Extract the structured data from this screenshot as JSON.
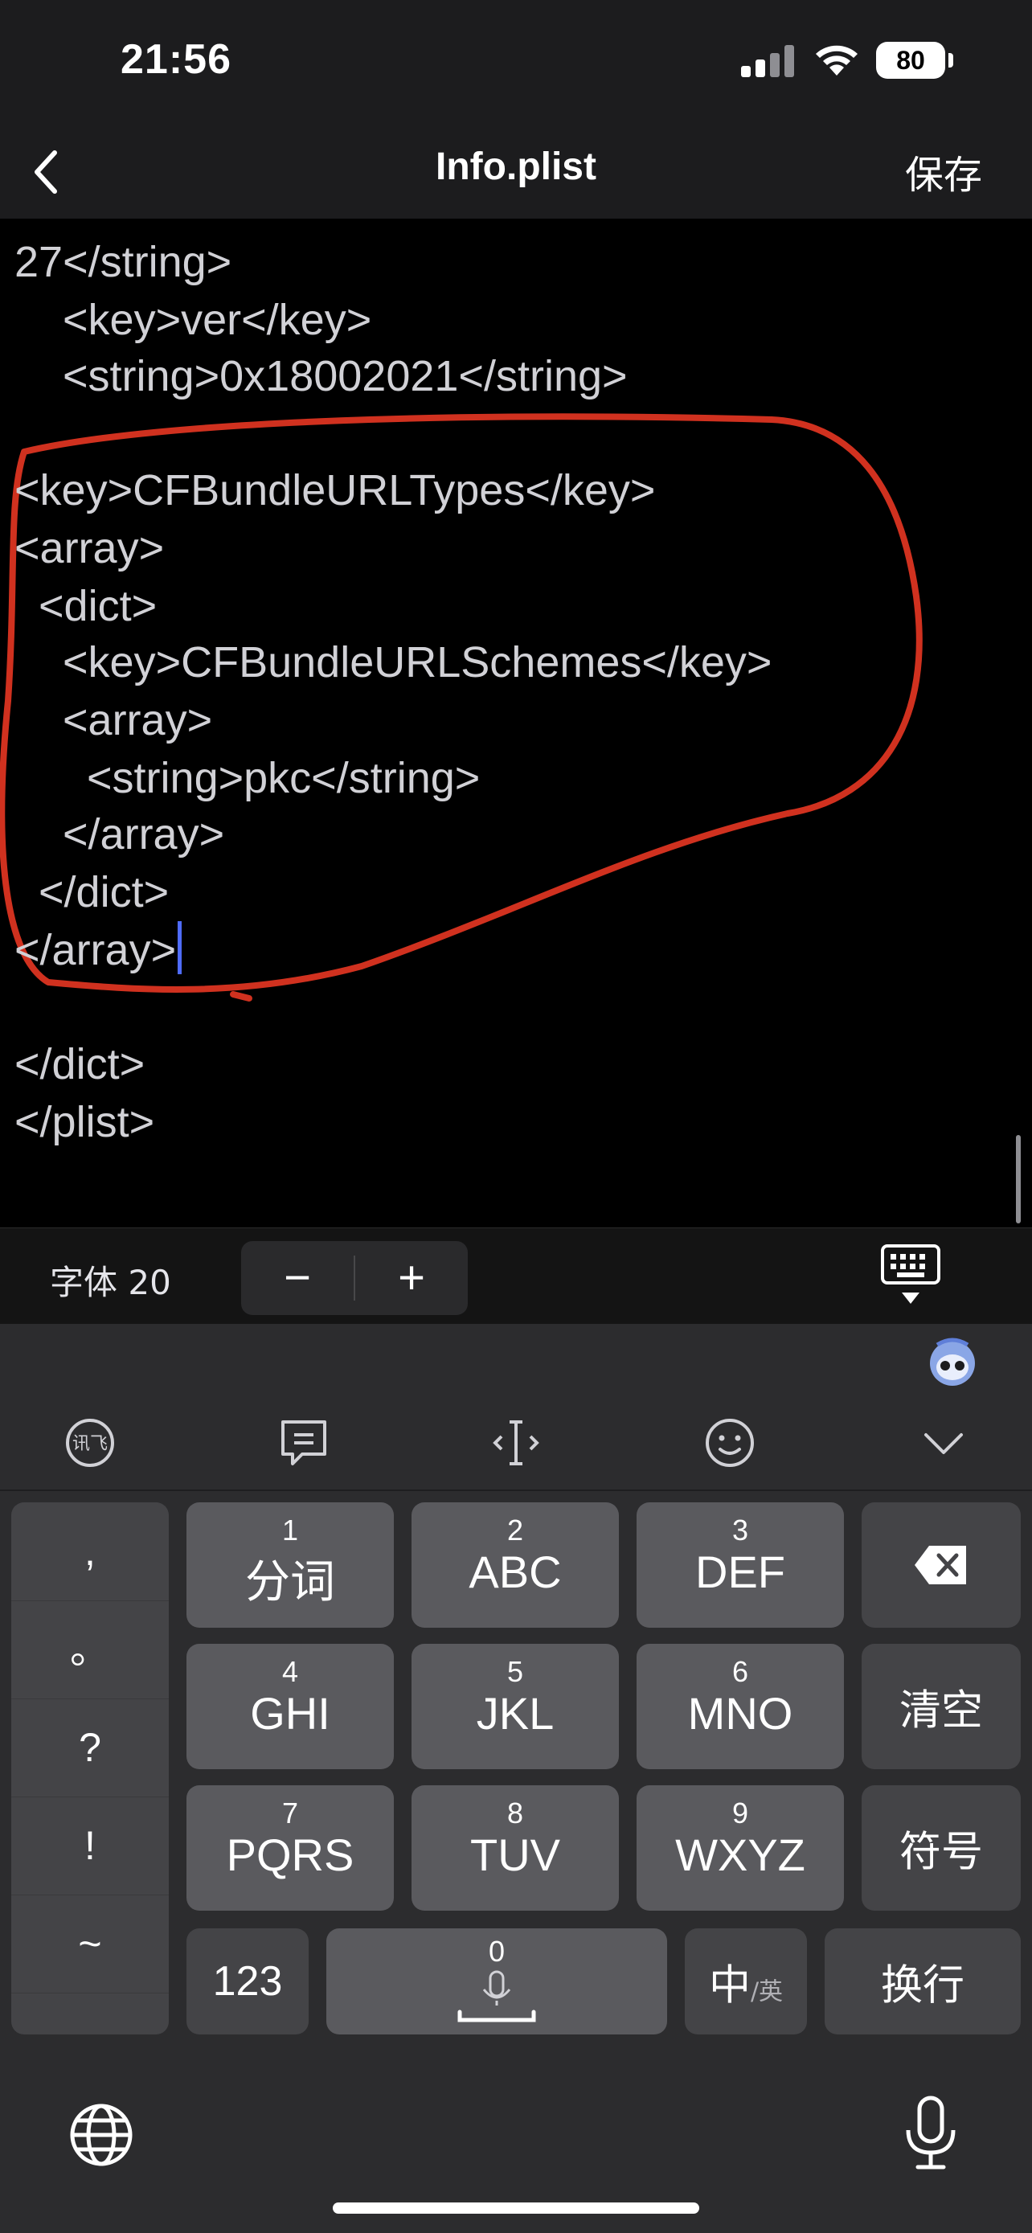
{
  "status_bar": {
    "time": "21:56",
    "battery": "80"
  },
  "nav": {
    "title": "Info.plist",
    "save_label": "保存"
  },
  "editor": {
    "lines": [
      "27</string>",
      "    <key>ver</key>",
      "    <string>0x18002021</string>",
      "",
      "<key>CFBundleURLTypes</key>",
      "<array>",
      "  <dict>",
      "    <key>CFBundleURLSchemes</key>",
      "    <array>",
      "      <string>pkc</string>",
      "    </array>",
      "  </dict>",
      "</array>",
      "",
      "</dict>",
      "</plist>"
    ],
    "annotation_color": "#d0311f",
    "cursor_color": "#4f6cff"
  },
  "font_toolbar": {
    "label": "字体 20",
    "minus": "−",
    "plus": "+"
  },
  "keyboard": {
    "toolbar_icons": [
      "xunfei-icon",
      "clipboard-icon",
      "cursor-move-icon",
      "emoji-icon",
      "collapse-chevron-icon"
    ],
    "punctuation": [
      ",",
      "。",
      "?",
      "!",
      "~"
    ],
    "keys": [
      {
        "num": "1",
        "letters": "分词"
      },
      {
        "num": "2",
        "letters": "ABC"
      },
      {
        "num": "3",
        "letters": "DEF"
      },
      {
        "num": "4",
        "letters": "GHI"
      },
      {
        "num": "5",
        "letters": "JKL"
      },
      {
        "num": "6",
        "letters": "MNO"
      },
      {
        "num": "7",
        "letters": "PQRS"
      },
      {
        "num": "8",
        "letters": "TUV"
      },
      {
        "num": "9",
        "letters": "WXYZ"
      }
    ],
    "clear_label": "清空",
    "symbol_label": "符号",
    "num_label": "123",
    "space_num": "0",
    "lang_main": "中",
    "lang_sub": "/英",
    "return_label": "换行"
  }
}
